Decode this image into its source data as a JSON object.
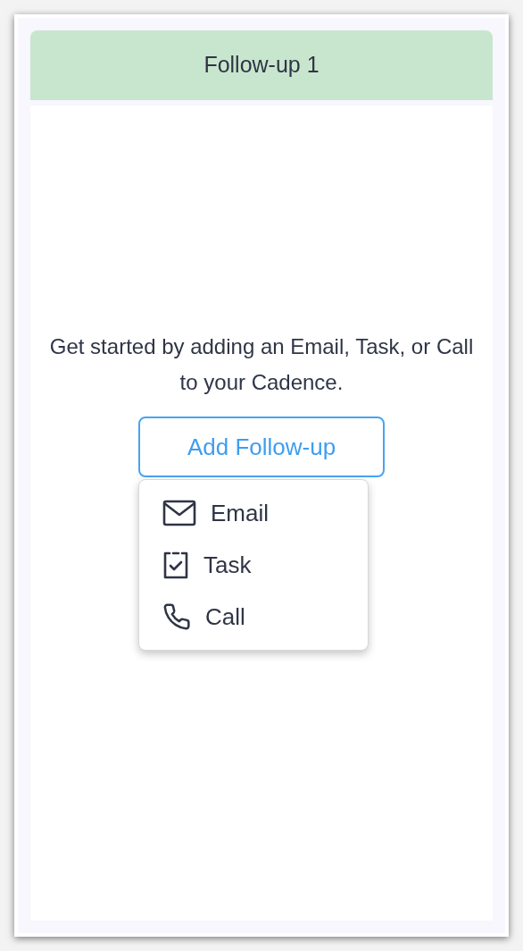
{
  "card": {
    "title": "Follow-up 1"
  },
  "empty_state": {
    "message": "Get started by adding an Email, Task, or Call to your Cadence.",
    "button": "Add Follow-up"
  },
  "menu": {
    "items": [
      {
        "kind": "email",
        "label": "Email"
      },
      {
        "kind": "task",
        "label": "Task"
      },
      {
        "kind": "call",
        "label": "Call"
      }
    ]
  }
}
